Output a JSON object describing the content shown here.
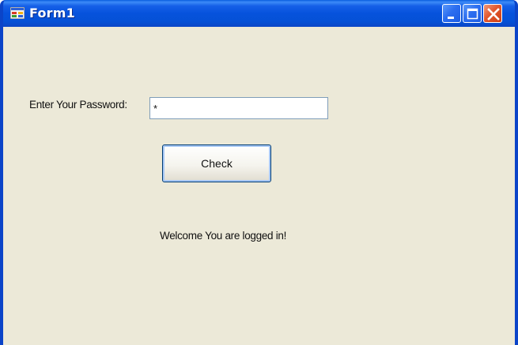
{
  "window": {
    "title": "Form1",
    "controls": {
      "minimize_icon": "minimize-icon",
      "maximize_icon": "maximize-icon",
      "close_icon": "close-icon"
    },
    "colors": {
      "titlebar": "#0551d6",
      "client_background": "#ece9d8",
      "close_button": "#e2582e"
    }
  },
  "form": {
    "password_label": "Enter Your Password:",
    "password_value": "*",
    "check_button_label": "Check",
    "status_message": "Welcome You are logged in!"
  }
}
